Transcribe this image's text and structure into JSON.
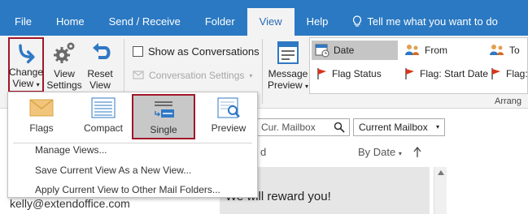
{
  "tabs": [
    "File",
    "Home",
    "Send / Receive",
    "Folder",
    "View",
    "Help"
  ],
  "active_tab": "View",
  "tell_me": "Tell me what you want to do",
  "ribbon": {
    "change_view": [
      "Change",
      "View"
    ],
    "view_settings": [
      "View",
      "Settings"
    ],
    "reset_view": [
      "Reset",
      "View"
    ],
    "show_as_conversations": "Show as Conversations",
    "conversation_settings": "Conversation Settings",
    "message_preview": [
      "Message",
      "Preview"
    ],
    "arrangement": {
      "items": [
        "Date",
        "From",
        "To",
        "Flag Status",
        "Flag: Start Date",
        "Flag:"
      ],
      "selected": "Date",
      "group_label": "Arrang"
    }
  },
  "dropdown": {
    "views": [
      "Flags",
      "Compact",
      "Single",
      "Preview"
    ],
    "selected_view": "Single",
    "menu": [
      "Manage Views...",
      "Save Current View As a New View...",
      "Apply Current View to Other Mail Folders..."
    ]
  },
  "content": {
    "search_placeholder": "n Cur. Mailbox",
    "mailbox_scope": "Current Mailbox",
    "list_header_fragment": "d",
    "sort_by": "By Date",
    "message_subject": "We will reward you!",
    "email_fragment": "kelly@extendoffice.com"
  },
  "colors": {
    "ribbon_blue": "#2b79c2",
    "highlight_red": "#a0162a"
  }
}
